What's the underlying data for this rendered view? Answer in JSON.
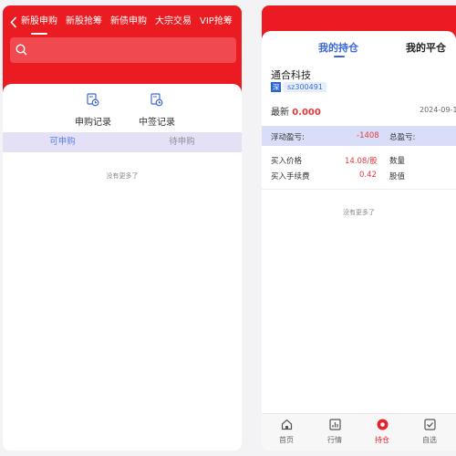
{
  "left": {
    "nav_tabs": [
      {
        "label": "新股申购"
      },
      {
        "label": "新股抢筹"
      },
      {
        "label": "新债申购"
      },
      {
        "label": "大宗交易"
      },
      {
        "label": "VIP抢筹"
      }
    ],
    "search": {
      "placeholder": ""
    },
    "quick_actions": [
      {
        "label": "申购记录"
      },
      {
        "label": "中签记录"
      }
    ],
    "sub_tabs": [
      {
        "label": "可申购"
      },
      {
        "label": "待申购"
      }
    ],
    "empty_text": "没有更多了"
  },
  "right": {
    "tabs": [
      {
        "label": "我的持仓"
      },
      {
        "label": "我的平仓"
      }
    ],
    "stock": {
      "name": "通合科技",
      "market": "深",
      "code": "sz300491",
      "latest_label": "最新",
      "latest_value": "0.000",
      "date": "2024-09-1"
    },
    "floating_pnl_label": "浮动盈亏:",
    "floating_pnl_value": "-1408",
    "total_pnl_label": "总盈亏:",
    "buy_price_label": "买入价格",
    "buy_price_value": "14.08/股",
    "quantity_label": "数量",
    "fee_label": "买入手续费",
    "fee_value": "0.42",
    "stock_value_label": "股值",
    "empty_text": "没有更多了",
    "bottom_nav": [
      {
        "label": "首页",
        "icon": "home-icon"
      },
      {
        "label": "行情",
        "icon": "chart-icon"
      },
      {
        "label": "持仓",
        "icon": "position-icon"
      },
      {
        "label": "自选",
        "icon": "checkbox-icon"
      }
    ]
  },
  "colors": {
    "brand_red": "#ea1c22",
    "accent_blue": "#2b63d9",
    "subtab_bg": "#e4e1f7",
    "pnl_bg": "#d8def8"
  }
}
